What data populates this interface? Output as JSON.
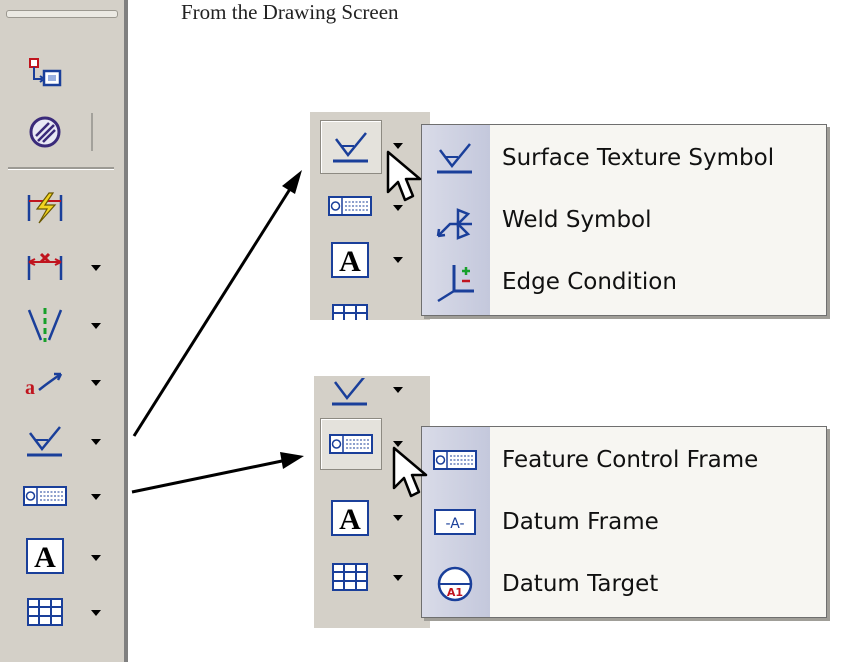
{
  "caption": "From the Drawing Screen",
  "toolbar": {
    "buttons": [
      {
        "icon": "view-transfer-icon",
        "dropdown": false
      },
      {
        "icon": "hatch-icon",
        "dropdown": false
      },
      {
        "icon": "break-dimension-icon",
        "dropdown": false
      },
      {
        "icon": "dimension-icon",
        "dropdown": true
      },
      {
        "icon": "centerline-icon",
        "dropdown": true
      },
      {
        "icon": "leader-note-icon",
        "dropdown": true
      },
      {
        "icon": "surface-texture-icon",
        "dropdown": true
      },
      {
        "icon": "feature-control-frame-icon",
        "dropdown": true
      },
      {
        "icon": "text-icon",
        "dropdown": true
      },
      {
        "icon": "table-icon",
        "dropdown": true
      }
    ]
  },
  "menu_surface": {
    "items": [
      {
        "label": "Surface Texture Symbol",
        "icon": "surface-texture-icon"
      },
      {
        "label": "Weld Symbol",
        "icon": "weld-symbol-icon"
      },
      {
        "label": "Edge Condition",
        "icon": "edge-condition-icon"
      }
    ]
  },
  "menu_fcf": {
    "items": [
      {
        "label": "Feature Control Frame",
        "icon": "feature-control-frame-icon"
      },
      {
        "label": "Datum Frame",
        "icon": "datum-frame-icon"
      },
      {
        "label": "Datum Target",
        "icon": "datum-target-icon"
      }
    ]
  },
  "datum_frame_glyph": "-A-",
  "datum_target_glyph": "A1",
  "text_glyph": "A",
  "colors": {
    "toolbar": "#d4d0c8",
    "menu": "#f7f6f2",
    "icon_blue": "#1a3f9a",
    "icon_red": "#c0141e"
  }
}
